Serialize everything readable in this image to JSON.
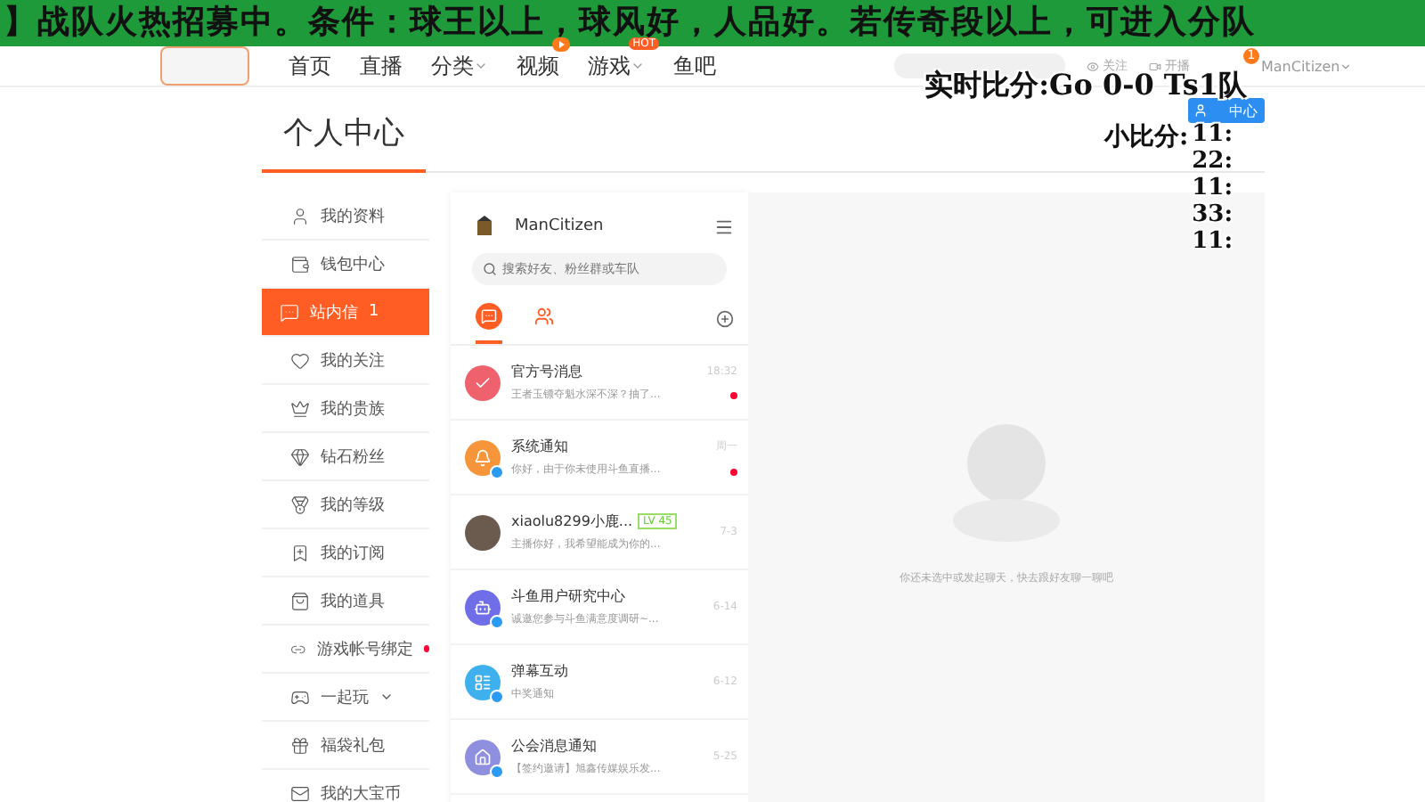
{
  "banner": {
    "text": "】战队火热招募中。条件：球王以上，球风好，人品好。若传奇段以上，可进入分队"
  },
  "nav": {
    "items": [
      {
        "label": "首页",
        "caret": false,
        "play_badge": false
      },
      {
        "label": "直播",
        "caret": false,
        "play_badge": false
      },
      {
        "label": "分类",
        "caret": true,
        "play_badge": false
      },
      {
        "label": "视频",
        "caret": false,
        "play_badge": true
      },
      {
        "label": "游戏",
        "caret": true,
        "play_badge": false,
        "hot": "HOT"
      },
      {
        "label": "鱼吧",
        "caret": false,
        "play_badge": false
      }
    ],
    "actions": [
      "关注",
      "开播"
    ],
    "user": "ManCitizen",
    "user_badge": "1"
  },
  "page": {
    "title": "个人中心",
    "center_button": "中心"
  },
  "sidebar": {
    "items": [
      {
        "label": "我的资料",
        "selected": false
      },
      {
        "label": "钱包中心",
        "selected": false
      },
      {
        "label": "站内信",
        "selected": true,
        "count": "1"
      },
      {
        "label": "我的关注",
        "selected": false
      },
      {
        "label": "我的贵族",
        "selected": false
      },
      {
        "label": "钻石粉丝",
        "selected": false
      },
      {
        "label": "我的等级",
        "selected": false
      },
      {
        "label": "我的订阅",
        "selected": false
      },
      {
        "label": "我的道具",
        "selected": false
      },
      {
        "label": "游戏帐号绑定",
        "selected": false,
        "dot": true
      },
      {
        "label": "一起玩",
        "selected": false,
        "expandable": true
      },
      {
        "label": "福袋礼包",
        "selected": false
      },
      {
        "label": "我的大宝币",
        "selected": false
      }
    ]
  },
  "messages": {
    "user": "ManCitizen",
    "search_placeholder": "搜索好友、粉丝群或车队",
    "tabs": [
      {
        "kind": "chat",
        "selected": true
      },
      {
        "kind": "friends",
        "selected": false
      }
    ],
    "items": [
      {
        "title": "官方号消息",
        "preview": "王者玉镖夺魁水深不深？抽了...",
        "time": "18:32",
        "unread": true,
        "verified": false,
        "kind": "icon",
        "color": "#f0616e"
      },
      {
        "title": "系统通知",
        "preview": "你好，由于你未使用斗鱼直播...",
        "time": "周一",
        "unread": true,
        "verified": true,
        "kind": "icon",
        "color": "#f7953a"
      },
      {
        "title": "xiaolu8299小鹿...",
        "level": "LV 45",
        "preview": "主播你好，我希望能成为你的...",
        "time": "7-3",
        "unread": false,
        "verified": false,
        "kind": "photo"
      },
      {
        "title": "斗鱼用户研究中心",
        "preview": "诚邀您参与斗鱼满意度调研~...",
        "time": "6-14",
        "unread": false,
        "verified": true,
        "kind": "icon",
        "color": "#6f6ee8"
      },
      {
        "title": "弹幕互动",
        "preview": "中奖通知",
        "time": "6-12",
        "unread": false,
        "verified": true,
        "kind": "icon",
        "color": "#3fb0ee"
      },
      {
        "title": "公会消息通知",
        "preview": "【签约邀请】旭鑫传媒娱乐发...",
        "time": "5-25",
        "unread": false,
        "verified": true,
        "kind": "icon",
        "color": "#8f8fe0"
      }
    ]
  },
  "chat": {
    "empty_text": "你还未选中或发起聊天，快去跟好友聊一聊吧"
  },
  "score": {
    "live": "实时比分:Go 0-0 Ts1队",
    "small_label": "小比分:",
    "small": [
      "11:",
      "22:",
      "11:",
      "33:",
      "11:"
    ]
  }
}
